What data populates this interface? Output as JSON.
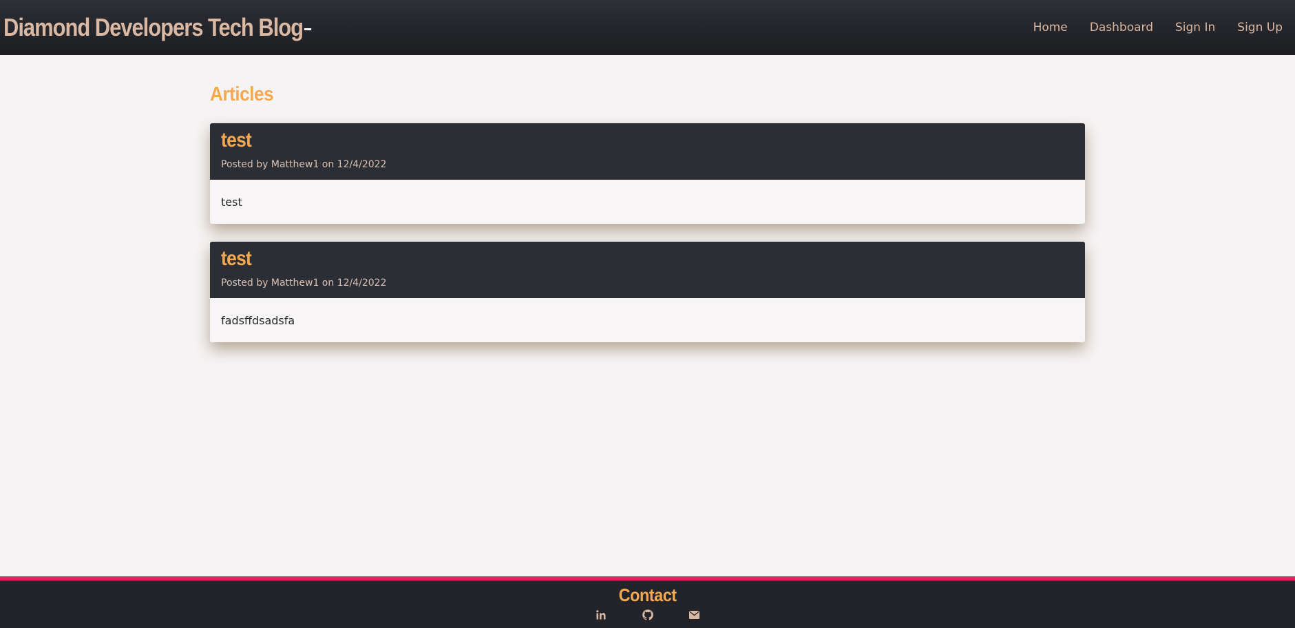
{
  "navbar": {
    "brand": "Diamond Developers Tech Blog",
    "links": [
      {
        "label": "Home"
      },
      {
        "label": "Dashboard"
      },
      {
        "label": "Sign In"
      },
      {
        "label": "Sign Up"
      }
    ]
  },
  "main": {
    "section_title": "Articles",
    "articles": [
      {
        "title": "test",
        "meta": "Posted by Matthew1 on 12/4/2022",
        "body": "test"
      },
      {
        "title": "test",
        "meta": "Posted by Matthew1 on 12/4/2022",
        "body": "fadsffdsadsfa"
      }
    ]
  },
  "footer": {
    "title": "Contact",
    "icons": [
      "linkedin-icon",
      "github-icon",
      "envelope-icon"
    ]
  },
  "colors": {
    "background": "#f6f3f4",
    "navbar": "#2c2e35",
    "accent": "#f4a950",
    "nav_text": "#d9b8a4",
    "footer_border": "#e0235f",
    "footer_bg": "#22242a"
  }
}
